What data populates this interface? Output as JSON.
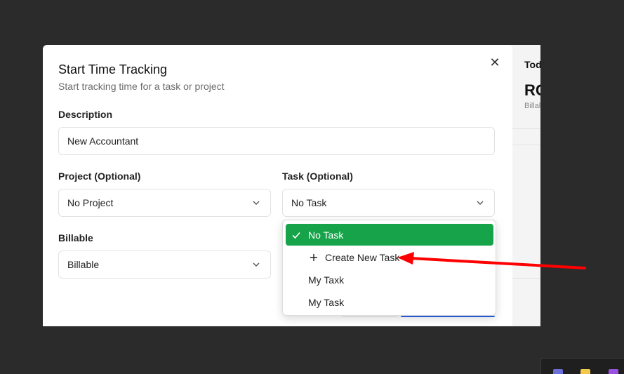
{
  "background": {
    "card_label": "Tod",
    "card_value": "RC",
    "card_sub": "Billal"
  },
  "modal": {
    "title": "Start Time Tracking",
    "subtitle": "Start tracking time for a task or project",
    "close_icon": "close-icon",
    "description": {
      "label": "Description",
      "value": "New Accountant"
    },
    "project": {
      "label": "Project (Optional)",
      "value": "No Project"
    },
    "task": {
      "label": "Task (Optional)",
      "value": "No Task"
    },
    "billable": {
      "label": "Billable",
      "value": "Billable"
    }
  },
  "task_dropdown": {
    "options": [
      {
        "label": "No Task",
        "selected": true,
        "icon": "check-icon"
      },
      {
        "label": "Create New Task",
        "selected": false,
        "icon": "plus-icon"
      },
      {
        "label": "My Taxk",
        "selected": false
      },
      {
        "label": "My Task",
        "selected": false
      }
    ]
  },
  "colors": {
    "accent_green": "#16a34a",
    "annotation_arrow": "#ff0000",
    "primary_button": "#2563eb"
  }
}
